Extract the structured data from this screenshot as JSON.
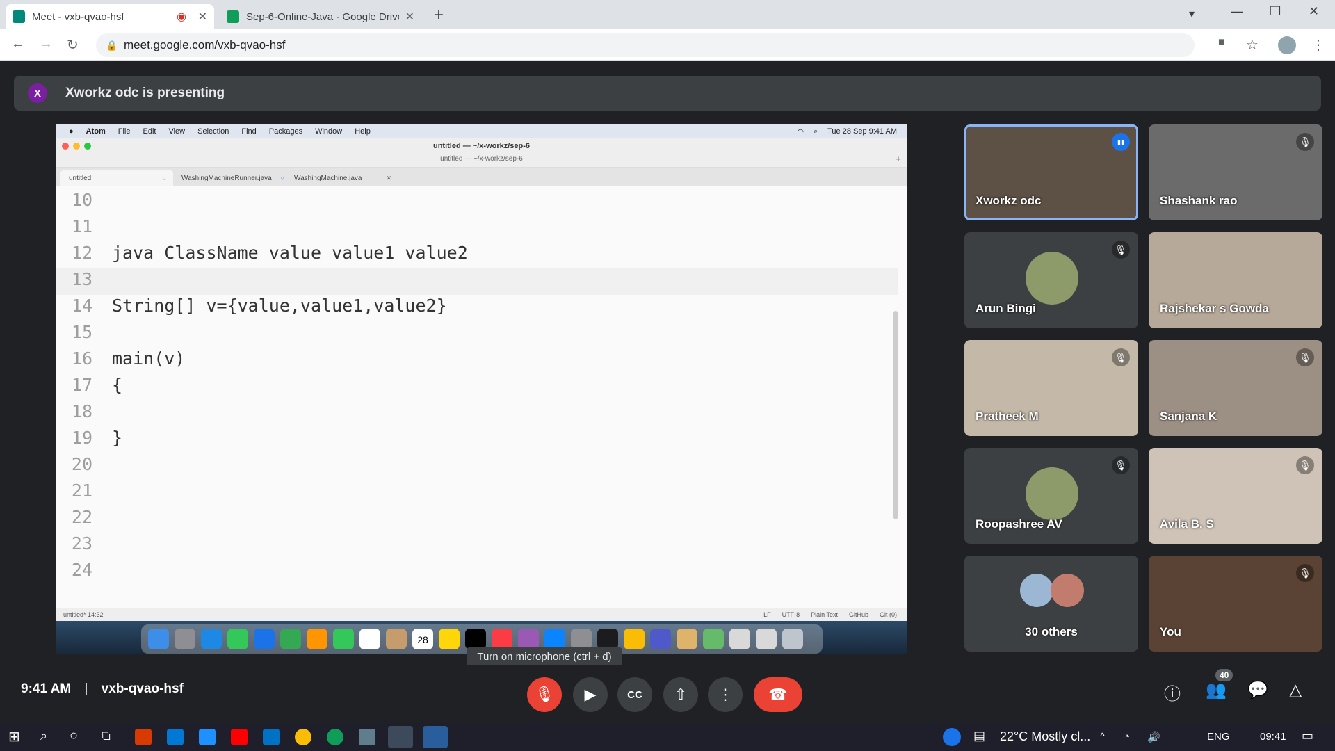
{
  "browser": {
    "tabs": [
      {
        "title": "Meet - vxb-qvao-hsf"
      },
      {
        "title": "Sep-6-Online-Java - Google Drive"
      }
    ],
    "url": "meet.google.com/vxb-qvao-hsf"
  },
  "meet": {
    "presenting_initial": "X",
    "presenting_text": "Xworkz odc is presenting",
    "tooltip": "Turn on microphone (ctrl + d)",
    "time": "9:41 AM",
    "separator": "|",
    "meeting_code": "vxb-qvao-hsf",
    "participant_count": "40",
    "participants": [
      {
        "name": "Xworkz odc",
        "muted": false,
        "speaking": true
      },
      {
        "name": "Shashank rao",
        "muted": true
      },
      {
        "name": "Arun Bingi",
        "muted": true
      },
      {
        "name": "Rajshekar s Gowda",
        "muted": false
      },
      {
        "name": "Pratheek M",
        "muted": true
      },
      {
        "name": "Sanjana K",
        "muted": true
      },
      {
        "name": "Roopashree AV",
        "muted": true
      },
      {
        "name": "Avila B. S",
        "muted": true
      },
      {
        "name": "30 others",
        "muted": false
      },
      {
        "name": "You",
        "muted": true
      }
    ]
  },
  "mac": {
    "menu": [
      "Atom",
      "File",
      "Edit",
      "View",
      "Selection",
      "Find",
      "Packages",
      "Window",
      "Help"
    ],
    "clock": "Tue 28 Sep  9:41 AM",
    "window_title": "untitled — ~/x-workz/sep-6",
    "window_subtitle": "untitled — ~/x-workz/sep-6",
    "tabs": [
      "untitled",
      "WashingMachineRunner.java",
      "WashingMachine.java"
    ],
    "lines": [
      {
        "n": "10",
        "code": ""
      },
      {
        "n": "11",
        "code": ""
      },
      {
        "n": "12",
        "code": "java ClassName value value1 value2"
      },
      {
        "n": "13",
        "code": ""
      },
      {
        "n": "14",
        "code": "String[] v={value,value1,value2}"
      },
      {
        "n": "15",
        "code": ""
      },
      {
        "n": "16",
        "code": "main(v)"
      },
      {
        "n": "17",
        "code": "{"
      },
      {
        "n": "18",
        "code": ""
      },
      {
        "n": "19",
        "code": "}"
      },
      {
        "n": "20",
        "code": ""
      },
      {
        "n": "21",
        "code": ""
      },
      {
        "n": "22",
        "code": ""
      },
      {
        "n": "23",
        "code": ""
      },
      {
        "n": "24",
        "code": ""
      }
    ],
    "status_left": "untitled*   14:32",
    "status_right": [
      "LF",
      "UTF-8",
      "Plain Text",
      "GitHub",
      "Git (0)"
    ],
    "dock_date": "28"
  },
  "windows": {
    "weather": "22°C  Mostly cl...",
    "lang": "ENG",
    "time": "09:41"
  }
}
